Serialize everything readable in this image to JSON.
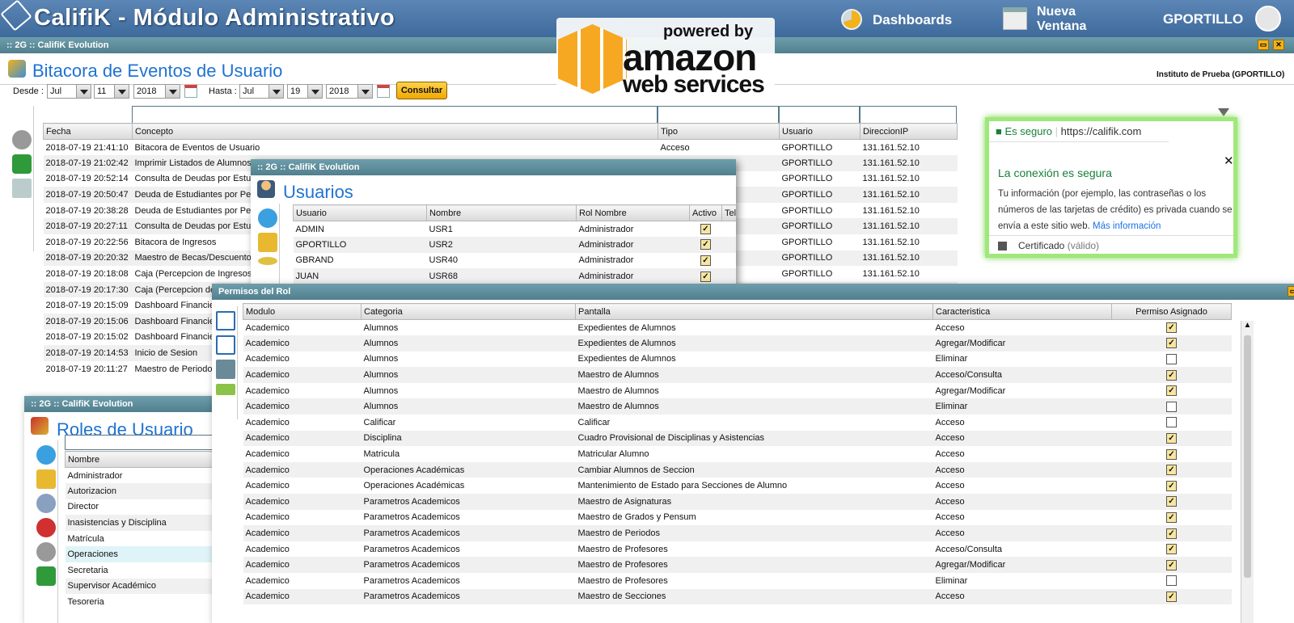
{
  "app": {
    "title": "CalifiK - Módulo Administrativo",
    "dashboards": "Dashboards",
    "new_window": "Nueva Ventana",
    "user": "GPORTILLO"
  },
  "aws": {
    "powered_by": "powered by",
    "amazon": "amazon",
    "web_services": "web services"
  },
  "colors": {
    "accent": "#1f73d2",
    "titlebar": "#517f8d",
    "check": "#f7e6a0",
    "button": "#f2b21b"
  },
  "main": {
    "window_title": ":: 2G :: CalifiK Evolution",
    "heading": "Bitacora de Eventos de Usuario",
    "institute": "Instituto de Prueba (GPORTILLO)",
    "desde": "Desde :",
    "hasta": "Hasta :",
    "from": {
      "month": "Jul",
      "day": "11",
      "year": "2018"
    },
    "to": {
      "month": "Jul",
      "day": "19",
      "year": "2018"
    },
    "consult": "Consultar",
    "columns": [
      "Fecha",
      "Concepto",
      "Tipo",
      "Usuario",
      "DireccionIP"
    ],
    "rows": [
      [
        "2018-07-19 21:41:10",
        "Bitacora de Eventos de Usuario",
        "Acceso",
        "GPORTILLO",
        "131.161.52.10"
      ],
      [
        "2018-07-19 21:02:42",
        "Imprimir Listados de Alumnos",
        "",
        "GPORTILLO",
        "131.161.52.10"
      ],
      [
        "2018-07-19 20:52:14",
        "Consulta de Deudas por Estu",
        "",
        "GPORTILLO",
        "131.161.52.10"
      ],
      [
        "2018-07-19 20:50:47",
        "Deuda de Estudiantes por Pe",
        "",
        "GPORTILLO",
        "131.161.52.10"
      ],
      [
        "2018-07-19 20:38:28",
        "Deuda de Estudiantes por Pe",
        "",
        "GPORTILLO",
        "131.161.52.10"
      ],
      [
        "2018-07-19 20:27:11",
        "Consulta de Deudas por Estu",
        "",
        "GPORTILLO",
        "131.161.52.10"
      ],
      [
        "2018-07-19 20:22:56",
        "Bitacora de Ingresos",
        "",
        "GPORTILLO",
        "131.161.52.10"
      ],
      [
        "2018-07-19 20:20:32",
        "Maestro de Becas/Descuento",
        "",
        "GPORTILLO",
        "131.161.52.10"
      ],
      [
        "2018-07-19 20:18:08",
        "Caja (Percepcion de Ingresos",
        "",
        "GPORTILLO",
        "131.161.52.10"
      ],
      [
        "2018-07-19 20:17:30",
        "Caja (Percepcion de",
        "",
        "",
        ""
      ],
      [
        "2018-07-19 20:15:09",
        "Dashboard Financie",
        "",
        "",
        ""
      ],
      [
        "2018-07-19 20:15:06",
        "Dashboard Financie",
        "",
        "",
        ""
      ],
      [
        "2018-07-19 20:15:02",
        "Dashboard Financie",
        "",
        "",
        ""
      ],
      [
        "2018-07-19 20:14:53",
        "Inicio de Sesion",
        "",
        "",
        ""
      ],
      [
        "2018-07-19 20:11:27",
        "Maestro de Periodo",
        "",
        "",
        ""
      ]
    ]
  },
  "usuarios": {
    "window_title": ":: 2G :: CalifiK Evolution",
    "heading": "Usuarios",
    "columns": [
      "Usuario",
      "Nombre",
      "Rol Nombre",
      "Activo",
      "Tele"
    ],
    "rows": [
      [
        "ADMIN",
        "USR1",
        "Administrador"
      ],
      [
        "GPORTILLO",
        "USR2",
        "Administrador"
      ],
      [
        "GBRAND",
        "USR40",
        "Administrador"
      ],
      [
        "JUAN",
        "USR68",
        "Administrador"
      ]
    ]
  },
  "roles": {
    "window_title": ":: 2G :: CalifiK Evolution",
    "heading": "Roles de Usuario",
    "column": "Nombre",
    "rows": [
      "Administrador",
      "Autorizacion",
      "Director",
      "Inasistencias y Disciplina",
      "Matrícula",
      "Operaciones",
      "Secretaria",
      "Supervisor Académico",
      "Tesoreria"
    ]
  },
  "security": {
    "secure": "Es seguro",
    "url": "https://califik.com",
    "title": "La conexión es segura",
    "body": "Tu información (por ejemplo, las contraseñas o los números de las tarjetas de crédito) es privada cuando se envía a este sitio web.",
    "more": "Más información",
    "cert": "Certificado",
    "valid": "(válido)"
  },
  "permisos": {
    "window_title": "Permisos del Rol",
    "columns": [
      "Modulo",
      "Categoria",
      "Pantalla",
      "Caracteristica",
      "Permiso Asignado"
    ],
    "rows": [
      [
        "Academico",
        "Alumnos",
        "Expedientes de Alumnos",
        "Acceso",
        true
      ],
      [
        "Academico",
        "Alumnos",
        "Expedientes de Alumnos",
        "Agregar/Modificar",
        true
      ],
      [
        "Academico",
        "Alumnos",
        "Expedientes de Alumnos",
        "Eliminar",
        false
      ],
      [
        "Academico",
        "Alumnos",
        "Maestro de Alumnos",
        "Acceso/Consulta",
        true
      ],
      [
        "Academico",
        "Alumnos",
        "Maestro de Alumnos",
        "Agregar/Modificar",
        true
      ],
      [
        "Academico",
        "Alumnos",
        "Maestro de Alumnos",
        "Eliminar",
        false
      ],
      [
        "Academico",
        "Calificar",
        "Calificar",
        "Acceso",
        false
      ],
      [
        "Academico",
        "Disciplina",
        "Cuadro Provisional de Disciplinas y Asistencias",
        "Acceso",
        true
      ],
      [
        "Academico",
        "Matricula",
        "Matricular Alumno",
        "Acceso",
        true
      ],
      [
        "Academico",
        "Operaciones Académicas",
        "Cambiar Alumnos de Seccion",
        "Acceso",
        true
      ],
      [
        "Academico",
        "Operaciones Académicas",
        "Mantenimiento de Estado para Secciones de Alumno",
        "Acceso",
        true
      ],
      [
        "Academico",
        "Parametros Academicos",
        "Maestro de Asignaturas",
        "Acceso",
        true
      ],
      [
        "Academico",
        "Parametros Academicos",
        "Maestro de Grados y Pensum",
        "Acceso",
        true
      ],
      [
        "Academico",
        "Parametros Academicos",
        "Maestro de Periodos",
        "Acceso",
        true
      ],
      [
        "Academico",
        "Parametros Academicos",
        "Maestro de Profesores",
        "Acceso/Consulta",
        true
      ],
      [
        "Academico",
        "Parametros Academicos",
        "Maestro de Profesores",
        "Agregar/Modificar",
        true
      ],
      [
        "Academico",
        "Parametros Academicos",
        "Maestro de Profesores",
        "Eliminar",
        false
      ],
      [
        "Academico",
        "Parametros Academicos",
        "Maestro de Secciones",
        "Acceso",
        true
      ]
    ]
  }
}
